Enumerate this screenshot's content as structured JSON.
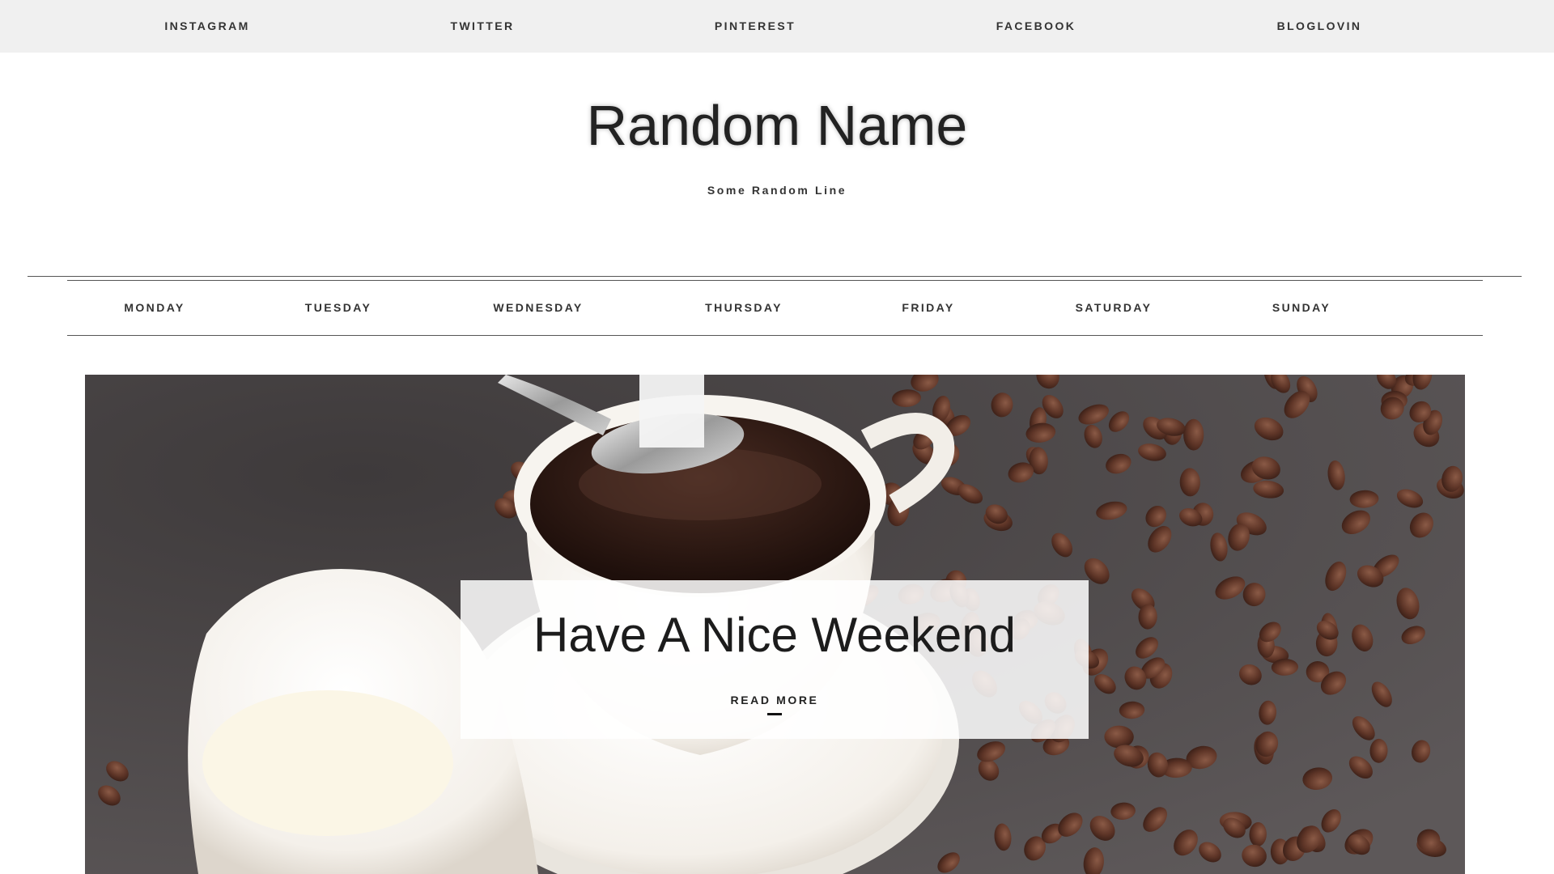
{
  "social": {
    "links": [
      "INSTAGRAM",
      "TWITTER",
      "PINTEREST",
      "FACEBOOK",
      "BLOGLOVIN"
    ]
  },
  "header": {
    "title": "Random Name",
    "tagline": "Some Random Line"
  },
  "nav": {
    "items": [
      "MONDAY",
      "TUESDAY",
      "WEDNESDAY",
      "THURSDAY",
      "FRIDAY",
      "SATURDAY",
      "SUNDAY"
    ]
  },
  "hero": {
    "image_subject": "coffee-cup-with-beans-photo",
    "post_title": "Have A Nice Weekend",
    "read_more": "READ MORE"
  },
  "colors": {
    "social_bar_bg": "#f0f0f0",
    "text": "#222222",
    "rule": "#555555"
  }
}
